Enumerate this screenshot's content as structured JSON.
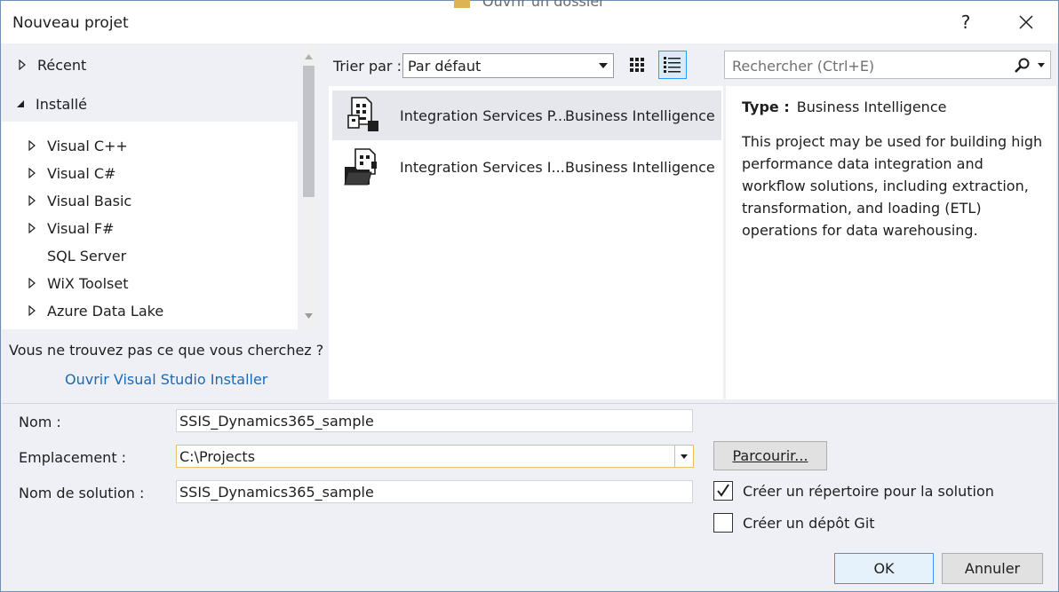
{
  "dialog": {
    "title": "Nouveau projet",
    "background_text": "Ouvrir un dossier",
    "help_label": "?"
  },
  "tree": {
    "recent": "Récent",
    "installed": "Installé",
    "items": [
      {
        "label": "Visual C++",
        "expandable": true
      },
      {
        "label": "Visual C#",
        "expandable": true
      },
      {
        "label": "Visual Basic",
        "expandable": true
      },
      {
        "label": "Visual F#",
        "expandable": true
      },
      {
        "label": "SQL Server",
        "expandable": false
      },
      {
        "label": "WiX Toolset",
        "expandable": true
      },
      {
        "label": "Azure Data Lake",
        "expandable": true
      }
    ]
  },
  "not_found": {
    "text": "Vous ne trouvez pas ce que vous cherchez ?",
    "link": "Ouvrir Visual Studio Installer"
  },
  "toolbar": {
    "sort_label": "Trier par :",
    "sort_value": "Par défaut",
    "search_placeholder": "Rechercher (Ctrl+E)"
  },
  "templates": [
    {
      "name": "Integration Services P...",
      "category": "Business Intelligence",
      "selected": true
    },
    {
      "name": "Integration Services I...",
      "category": "Business Intelligence",
      "selected": false
    }
  ],
  "details": {
    "type_label": "Type :",
    "type_value": "Business Intelligence",
    "description": "This project may be used for building high performance data integration and workflow solutions, including extraction, transformation, and loading (ETL) operations for data warehousing."
  },
  "form": {
    "name_label": "Nom :",
    "name_value": "SSIS_Dynamics365_sample",
    "location_label": "Emplacement :",
    "location_value": "C:\\Projects",
    "solution_label": "Nom de solution :",
    "solution_value": "SSIS_Dynamics365_sample",
    "browse_label": "Parcourir...",
    "create_dir_label": "Créer un répertoire pour la solution",
    "create_dir_checked": true,
    "create_git_label": "Créer un dépôt Git",
    "create_git_checked": false,
    "ok_label": "OK",
    "cancel_label": "Annuler"
  },
  "colors": {
    "accent": "#3399ff",
    "link": "#1e69b4",
    "panel": "#eef0f5",
    "focus_border": "#e5c365"
  }
}
